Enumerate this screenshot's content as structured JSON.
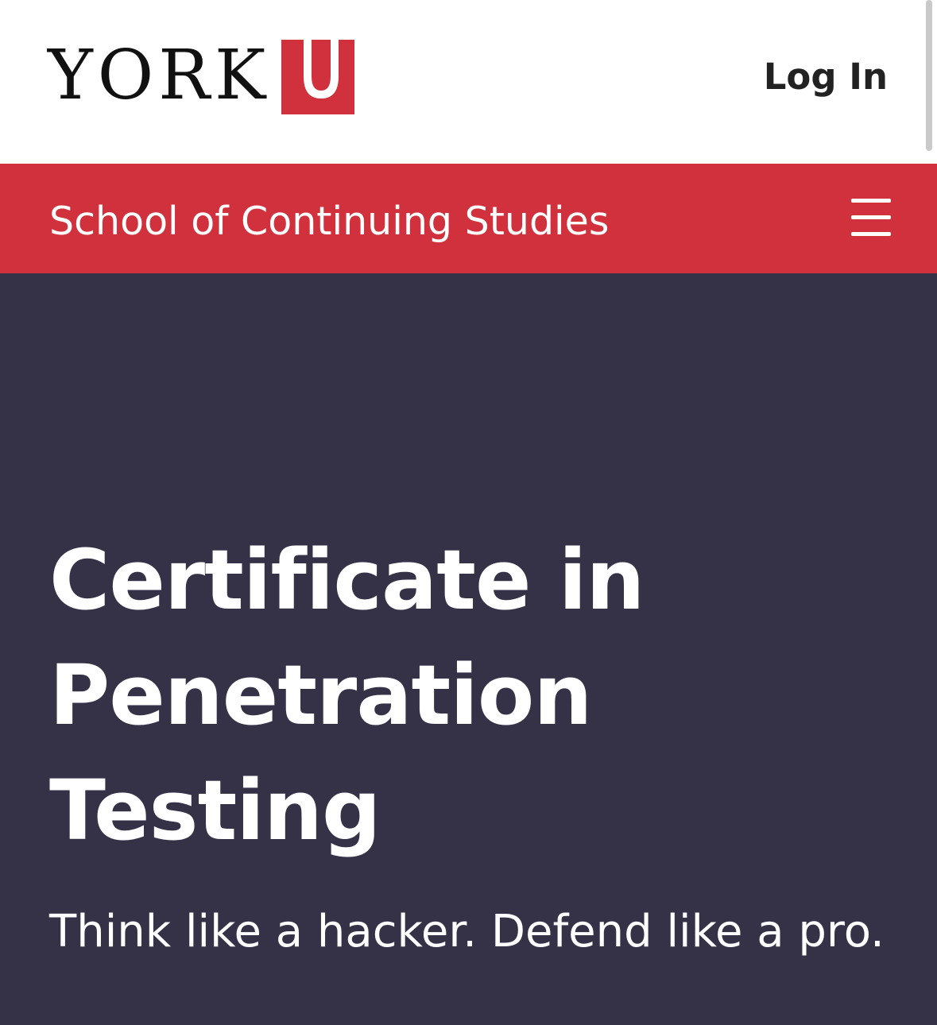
{
  "header": {
    "logo": {
      "wordmark": "YORK",
      "box_letter": "U",
      "brand_color": "#d1313d"
    },
    "login_label": "Log In"
  },
  "program_bar": {
    "title": "School of Continuing Studies",
    "menu_icon": "hamburger-menu-icon",
    "background_color": "#d1313d"
  },
  "hero": {
    "title_lines": [
      "Certificate in",
      "Penetration",
      "Testing"
    ],
    "tagline": "Think like a hacker. Defend like a pro.",
    "background_color": "#353248"
  }
}
